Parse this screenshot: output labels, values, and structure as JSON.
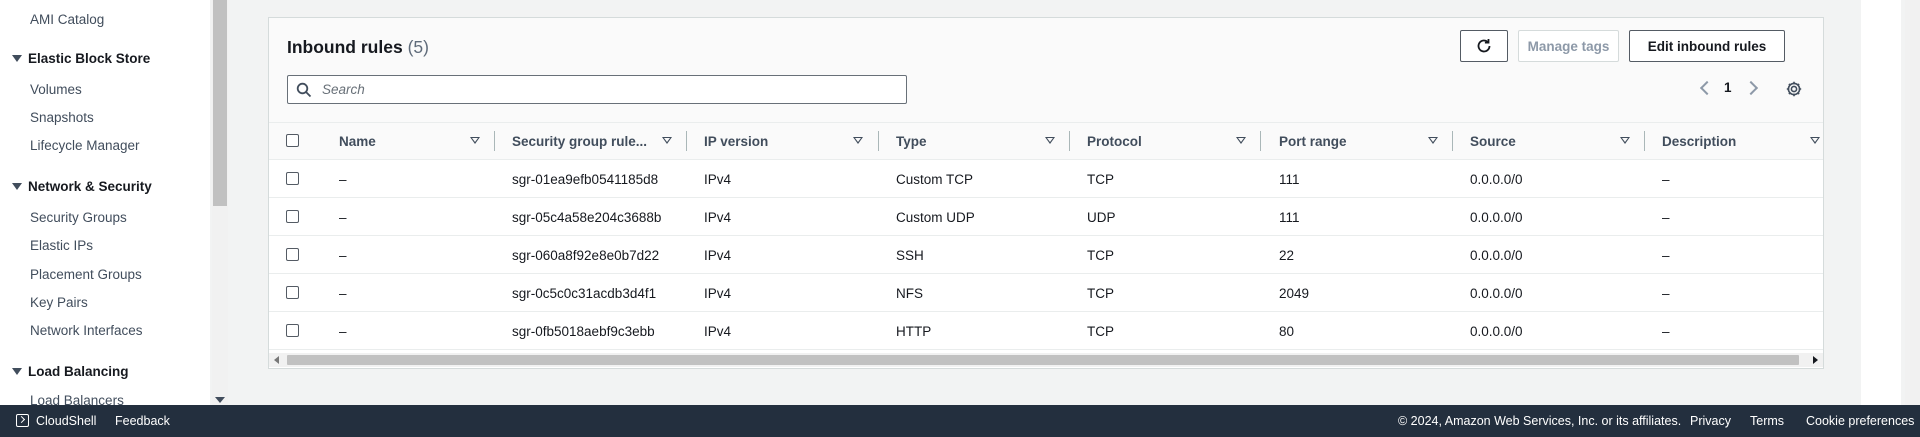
{
  "sidebar": {
    "top_link": "AMI Catalog",
    "sections": [
      {
        "title": "Elastic Block Store",
        "items": [
          "Volumes",
          "Snapshots",
          "Lifecycle Manager"
        ]
      },
      {
        "title": "Network & Security",
        "items": [
          "Security Groups",
          "Elastic IPs",
          "Placement Groups",
          "Key Pairs",
          "Network Interfaces"
        ]
      },
      {
        "title": "Load Balancing",
        "items": [
          "Load Balancers"
        ]
      }
    ]
  },
  "panel": {
    "title": "Inbound rules",
    "count": "(5)",
    "refresh_icon": "refresh-icon",
    "manage_tags_label": "Manage tags",
    "edit_label": "Edit inbound rules",
    "search_placeholder": "Search",
    "page_number": "1",
    "settings_icon": "gear-icon"
  },
  "table": {
    "columns": [
      "Name",
      "Security group rule...",
      "IP version",
      "Type",
      "Protocol",
      "Port range",
      "Source",
      "Description"
    ],
    "rows": [
      {
        "name": "–",
        "rule_id": "sgr-01ea9efb0541185d8",
        "ip_version": "IPv4",
        "type": "Custom TCP",
        "protocol": "TCP",
        "port_range": "111",
        "source": "0.0.0.0/0",
        "description": "–"
      },
      {
        "name": "–",
        "rule_id": "sgr-05c4a58e204c3688b",
        "ip_version": "IPv4",
        "type": "Custom UDP",
        "protocol": "UDP",
        "port_range": "111",
        "source": "0.0.0.0/0",
        "description": "–"
      },
      {
        "name": "–",
        "rule_id": "sgr-060a8f92e8e0b7d22",
        "ip_version": "IPv4",
        "type": "SSH",
        "protocol": "TCP",
        "port_range": "22",
        "source": "0.0.0.0/0",
        "description": "–"
      },
      {
        "name": "–",
        "rule_id": "sgr-0c5c0c31acdb3d4f1",
        "ip_version": "IPv4",
        "type": "NFS",
        "protocol": "TCP",
        "port_range": "2049",
        "source": "0.0.0.0/0",
        "description": "–"
      },
      {
        "name": "–",
        "rule_id": "sgr-0fb5018aebf9c3ebb",
        "ip_version": "IPv4",
        "type": "HTTP",
        "protocol": "TCP",
        "port_range": "80",
        "source": "0.0.0.0/0",
        "description": "–"
      }
    ]
  },
  "footer": {
    "cloudshell": "CloudShell",
    "feedback": "Feedback",
    "copyright": "© 2024, Amazon Web Services, Inc. or its affiliates.",
    "privacy": "Privacy",
    "terms": "Terms",
    "cookie": "Cookie preferences"
  },
  "colors": {
    "footer_bg": "#232f3e",
    "page_bg": "#f2f3f3",
    "border": "#d5dbdb"
  }
}
